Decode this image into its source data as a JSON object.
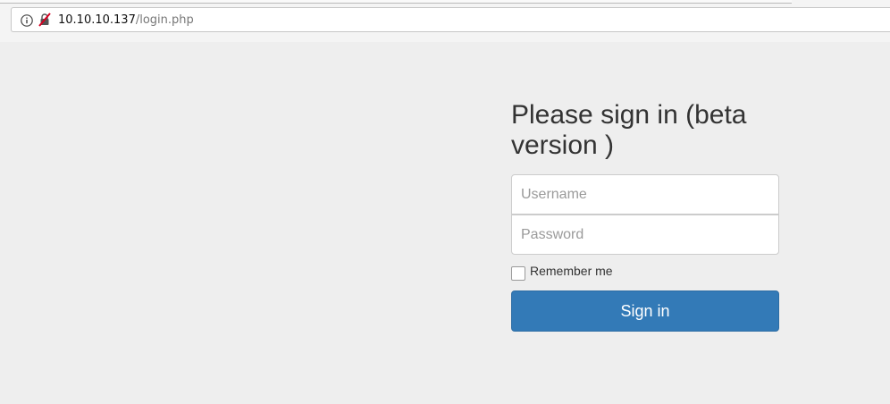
{
  "browser": {
    "url_host": "10.10.10.137",
    "url_path": "/login.php",
    "icons": [
      "info-icon",
      "insecure-lock-icon"
    ]
  },
  "login": {
    "heading": "Please sign in (beta version )",
    "username_placeholder": "Username",
    "password_placeholder": "Password",
    "remember_label": "Remember me",
    "remember_checked": false,
    "submit_label": "Sign in"
  },
  "colors": {
    "page_background": "#eeeeee",
    "primary_button": "#337ab7",
    "heading_text": "#333333"
  }
}
